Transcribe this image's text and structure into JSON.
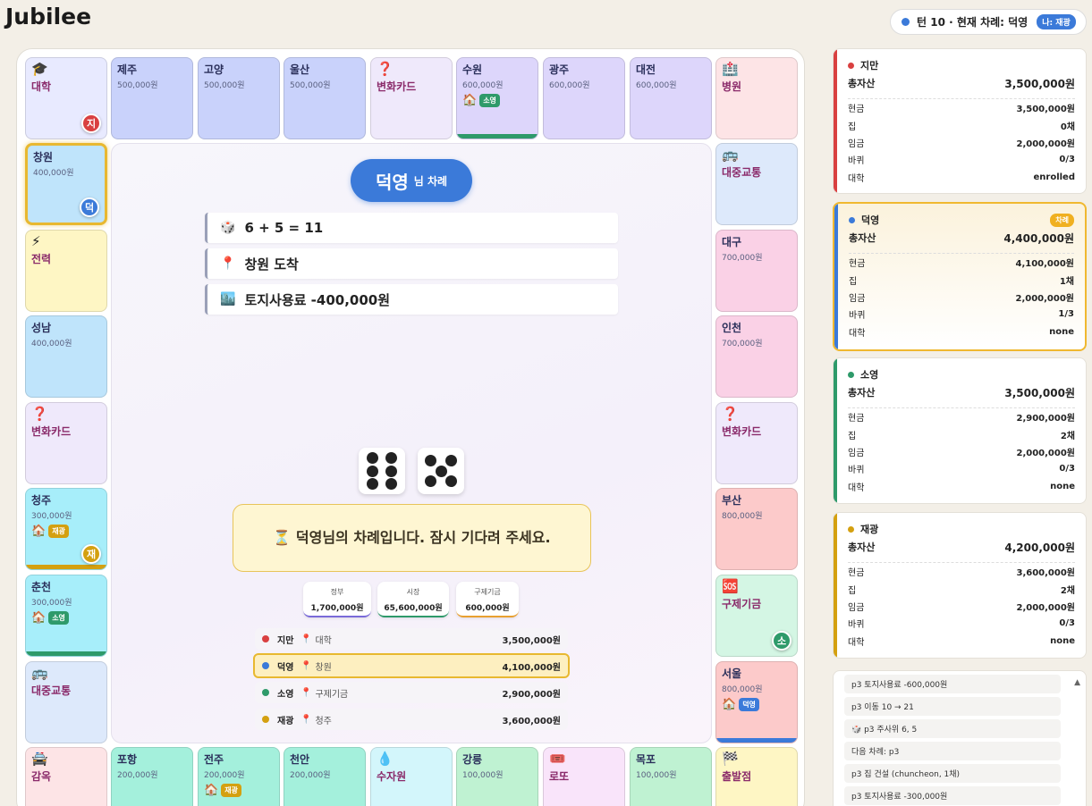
{
  "app": {
    "title": "Jubilee"
  },
  "turn_pill": {
    "text": "턴 10 · 현재 차례: 덕영",
    "me": "나: 재광"
  },
  "tiles": [
    {
      "id": "daehak",
      "name": "대학",
      "icon": "🎓",
      "special": true,
      "bg": "#e8eaff",
      "token": {
        "label": "지",
        "color": "#d94040"
      }
    },
    {
      "id": "jeju",
      "name": "제주",
      "price": "500,000원",
      "bg": "#c9d2fb"
    },
    {
      "id": "goyang",
      "name": "고양",
      "price": "500,000원",
      "bg": "#c9d2fb"
    },
    {
      "id": "ulsan",
      "name": "울산",
      "price": "500,000원",
      "bg": "#c9d2fb"
    },
    {
      "id": "chance-top",
      "name": "변화카드",
      "icon": "❓",
      "special": true,
      "bg": "#efe9fb"
    },
    {
      "id": "suwon",
      "name": "수원",
      "price": "600,000원",
      "bg": "#ddd6fb",
      "owner": {
        "label": "소영",
        "color": "#2e9a6a"
      },
      "bar": "#2e9a6a"
    },
    {
      "id": "gwangju",
      "name": "광주",
      "price": "600,000원",
      "bg": "#ddd6fb"
    },
    {
      "id": "daejeon",
      "name": "대전",
      "price": "600,000원",
      "bg": "#ddd6fb"
    },
    {
      "id": "hospital",
      "name": "병원",
      "icon": "🏥",
      "special": true,
      "bg": "#fde4e6"
    },
    {
      "id": "changwon",
      "name": "창원",
      "price": "400,000원",
      "bg": "#bfe4fb",
      "current": true,
      "token": {
        "label": "덕",
        "color": "#3b7ad9"
      }
    },
    {
      "id": "power",
      "name": "전력",
      "icon": "⚡",
      "special": true,
      "bg": "#fef6c4"
    },
    {
      "id": "seongnam",
      "name": "성남",
      "price": "400,000원",
      "bg": "#bfe4fb"
    },
    {
      "id": "chance-left",
      "name": "변화카드",
      "icon": "❓",
      "special": true,
      "bg": "#efe9fb"
    },
    {
      "id": "cheongju",
      "name": "청주",
      "price": "300,000원",
      "bg": "#a7eefa",
      "owner": {
        "label": "재광",
        "color": "#d4a010"
      },
      "bar": "#d4a010",
      "token": {
        "label": "재",
        "color": "#d4a010"
      }
    },
    {
      "id": "chuncheon",
      "name": "춘천",
      "price": "300,000원",
      "bg": "#a7eefa",
      "owner": {
        "label": "소영",
        "color": "#2e9a6a"
      },
      "bar": "#2e9a6a"
    },
    {
      "id": "transit-left",
      "name": "대중교통",
      "icon": "🚌",
      "special": true,
      "bg": "#dde9fb"
    },
    {
      "id": "transit-right",
      "name": "대중교통",
      "icon": "🚌",
      "special": true,
      "bg": "#dde9fb"
    },
    {
      "id": "daegu",
      "name": "대구",
      "price": "700,000원",
      "bg": "#fad1e6"
    },
    {
      "id": "incheon",
      "name": "인천",
      "price": "700,000원",
      "bg": "#fad1e6"
    },
    {
      "id": "chance-right",
      "name": "변화카드",
      "icon": "❓",
      "special": true,
      "bg": "#efe9fb"
    },
    {
      "id": "busan",
      "name": "부산",
      "price": "800,000원",
      "bg": "#fccaca"
    },
    {
      "id": "relief",
      "name": "구제기금",
      "icon": "🆘",
      "special": true,
      "bg": "#d4f6e4",
      "token": {
        "label": "소",
        "color": "#2e9a6a"
      }
    },
    {
      "id": "seoul",
      "name": "서울",
      "price": "800,000원",
      "bg": "#fccaca",
      "owner": {
        "label": "덕영",
        "color": "#3b7ad9"
      },
      "bar": "#3b7ad9"
    },
    {
      "id": "jail",
      "name": "감옥",
      "icon": "🚔",
      "special": true,
      "bg": "#fde4e6"
    },
    {
      "id": "pohang",
      "name": "포항",
      "price": "200,000원",
      "bg": "#a4f0dc"
    },
    {
      "id": "jeonju",
      "name": "전주",
      "price": "200,000원",
      "bg": "#a4f0dc",
      "owner": {
        "label": "재광",
        "color": "#d4a010"
      }
    },
    {
      "id": "cheonan",
      "name": "천안",
      "price": "200,000원",
      "bg": "#a4f0dc"
    },
    {
      "id": "water",
      "name": "수자원",
      "icon": "💧",
      "special": true,
      "bg": "#d3f6fb"
    },
    {
      "id": "gangneung",
      "name": "강릉",
      "price": "100,000원",
      "bg": "#bff2d2"
    },
    {
      "id": "lotto",
      "name": "로또",
      "icon": "🎟️",
      "special": true,
      "bg": "#f9e4fa"
    },
    {
      "id": "mokpo",
      "name": "목포",
      "price": "100,000원",
      "bg": "#bff2d2"
    },
    {
      "id": "start",
      "name": "출발점",
      "icon": "🏁",
      "special": true,
      "bg": "#fef6c4"
    }
  ],
  "center": {
    "turn_name": "덕영",
    "turn_suffix": "님 차례",
    "log": [
      {
        "icon": "🎲",
        "text": "6 + 5 = 11"
      },
      {
        "icon": "📍",
        "text": "창원 도착"
      },
      {
        "icon": "🏙️",
        "text": "토지사용료 -400,000원"
      }
    ],
    "dice": [
      6,
      5
    ],
    "wait_message": "⏳ 덕영님의 차례입니다. 잠시 기다려 주세요.",
    "funds": [
      {
        "label": "정부",
        "value": "1,700,000원",
        "color": "#7a6ad9"
      },
      {
        "label": "시장",
        "value": "65,600,000원",
        "color": "#2e9a6a"
      },
      {
        "label": "구제기금",
        "value": "600,000원",
        "color": "#e8a030"
      }
    ],
    "players": [
      {
        "name": "지만",
        "loc": "대학",
        "cash": "3,500,000원",
        "color": "#d94040"
      },
      {
        "name": "덕영",
        "loc": "창원",
        "cash": "4,100,000원",
        "color": "#3b7ad9",
        "active": true
      },
      {
        "name": "소영",
        "loc": "구제기금",
        "cash": "2,900,000원",
        "color": "#2e9a6a"
      },
      {
        "name": "재광",
        "loc": "청주",
        "cash": "3,600,000원",
        "color": "#d4a010"
      }
    ],
    "loc_icon": "📍"
  },
  "labels": {
    "total": "총자산",
    "cash": "현금",
    "houses": "집",
    "wage": "임금",
    "laps": "바퀴",
    "univ": "대학",
    "turn_badge": "차례"
  },
  "player_cards": [
    {
      "name": "지만",
      "color": "#d94040",
      "total": "3,500,000원",
      "cash": "3,500,000원",
      "houses": "0채",
      "wage": "2,000,000원",
      "laps": "0/3",
      "univ": "enrolled"
    },
    {
      "name": "덕영",
      "color": "#3b7ad9",
      "total": "4,400,000원",
      "cash": "4,100,000원",
      "houses": "1채",
      "wage": "2,000,000원",
      "laps": "1/3",
      "univ": "none",
      "active": true
    },
    {
      "name": "소영",
      "color": "#2e9a6a",
      "total": "3,500,000원",
      "cash": "2,900,000원",
      "houses": "2채",
      "wage": "2,000,000원",
      "laps": "0/3",
      "univ": "none"
    },
    {
      "name": "재광",
      "color": "#d4a010",
      "total": "4,200,000원",
      "cash": "3,600,000원",
      "houses": "2채",
      "wage": "2,000,000원",
      "laps": "0/3",
      "univ": "none"
    }
  ],
  "event_log": [
    "p3 토지사용료 -600,000원",
    "p3 이동 10 → 21",
    "🎲 p3 주사위 6, 5",
    "다음 차례: p3",
    "p3 집 건설 (chuncheon, 1채)",
    "p3 토지사용료 -300,000원"
  ]
}
